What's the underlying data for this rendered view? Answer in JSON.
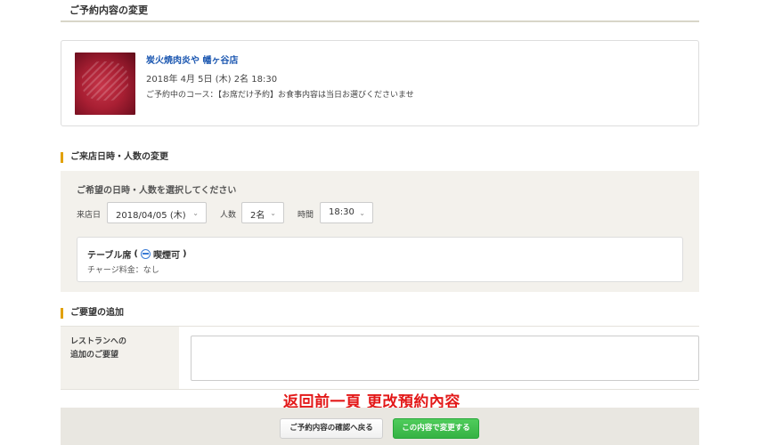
{
  "page": {
    "title": "ご予約内容の変更"
  },
  "reservation": {
    "restaurant_name": "炭火焼肉炎や 幡ヶ谷店",
    "datetime": "2018年 4月 5日 (木)  2名  18:30",
    "course": "ご予約中のコース：【お席だけ予約】お食事内容は当日お選びくださいませ",
    "photo_icon": "meat-photo"
  },
  "date_section": {
    "heading": "ご来店日時・人数の変更",
    "prompt": "ご希望の日時・人数を選択してください",
    "date_label": "来店日",
    "date_value": "2018/04/05 (木)",
    "people_label": "人数",
    "people_value": "2名",
    "time_label": "時間",
    "time_value": "18:30",
    "caret_glyph": "⌄",
    "seat": {
      "name": "テーブル席",
      "open_paren": "(",
      "smoking": "喫煙可",
      "close_paren": ")",
      "charge": "チャージ料金：なし"
    }
  },
  "request_section": {
    "heading": "ご要望の追加",
    "label": "レストランへの\n追加のご要望",
    "value": ""
  },
  "annotation": {
    "text": "返回前一頁  更改預約內容",
    "color": "#e31818"
  },
  "footer": {
    "back_button": "ご予約内容の確認へ戻る",
    "submit_button": "この内容で変更する"
  },
  "colors": {
    "accent": "#e2a100",
    "link": "#1a56b0",
    "submit": "#35b244",
    "panel": "#f3f1ec"
  }
}
